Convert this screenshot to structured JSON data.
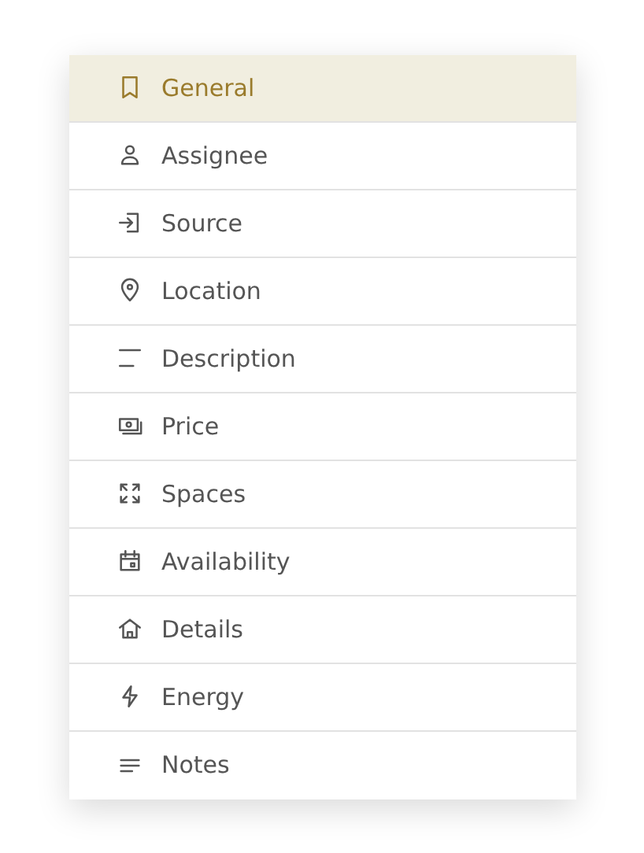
{
  "menu": {
    "items": [
      {
        "label": "General",
        "selected": true
      },
      {
        "label": "Assignee",
        "selected": false
      },
      {
        "label": "Source",
        "selected": false
      },
      {
        "label": "Location",
        "selected": false
      },
      {
        "label": "Description",
        "selected": false
      },
      {
        "label": "Price",
        "selected": false
      },
      {
        "label": "Spaces",
        "selected": false
      },
      {
        "label": "Availability",
        "selected": false
      },
      {
        "label": "Details",
        "selected": false
      },
      {
        "label": "Energy",
        "selected": false
      },
      {
        "label": "Notes",
        "selected": false
      }
    ]
  }
}
